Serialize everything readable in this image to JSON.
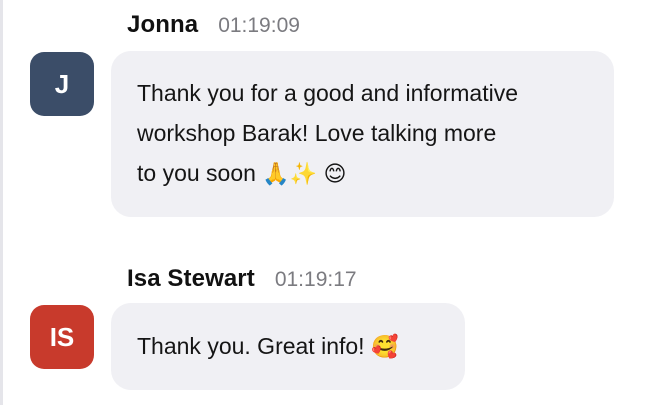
{
  "messages": [
    {
      "sender": "Jonna",
      "time": "01:19:09",
      "avatar_initials": "J",
      "avatar_color": "#3b4d68",
      "text_lines": [
        "Thank you for a good and informative",
        "workshop Barak! Love talking more",
        "to you soon"
      ],
      "emojis": [
        "🙏",
        "✨",
        "😊"
      ]
    },
    {
      "sender": "Isa Stewart",
      "time": "01:19:17",
      "avatar_initials": "IS",
      "avatar_color": "#c83a2c",
      "text": "Thank you. Great info!",
      "emoji": "🥰"
    }
  ]
}
